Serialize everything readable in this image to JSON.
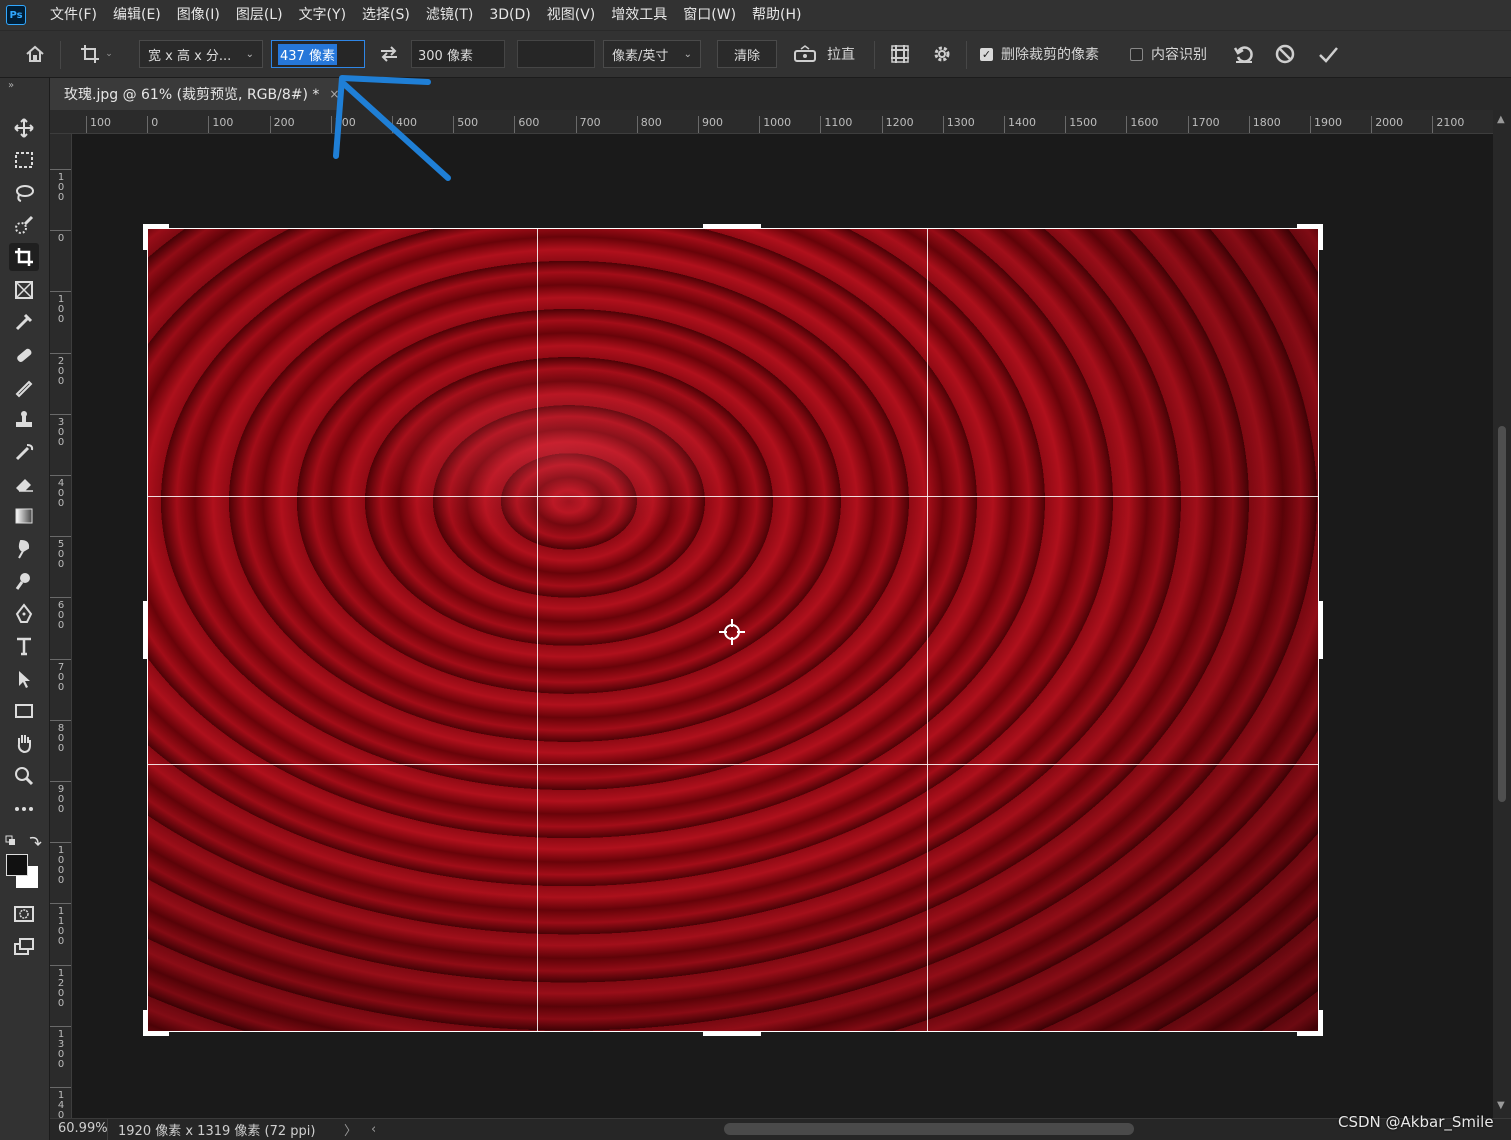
{
  "app": {
    "logo": "Ps"
  },
  "menu": [
    "文件(F)",
    "编辑(E)",
    "图像(I)",
    "图层(L)",
    "文字(Y)",
    "选择(S)",
    "滤镜(T)",
    "3D(D)",
    "视图(V)",
    "增效工具",
    "窗口(W)",
    "帮助(H)"
  ],
  "options": {
    "ratio_preset": "宽 x 高 x 分...",
    "width_value": "437 像素",
    "height_value": "300 像素",
    "resolution_value": "",
    "resolution_unit": "像素/英寸",
    "clear_label": "清除",
    "straighten_label": "拉直",
    "delete_cropped_label": "删除裁剪的像素",
    "delete_cropped_checked": true,
    "content_aware_label": "内容识别",
    "content_aware_checked": false
  },
  "document": {
    "tab_title": "玫瑰.jpg @ 61% (裁剪预览, RGB/8#) *",
    "close_glyph": "×"
  },
  "ruler": {
    "top_labels": [
      "100",
      "0",
      "100",
      "200",
      "300",
      "400",
      "500",
      "600",
      "700",
      "800",
      "900",
      "1000",
      "1100",
      "1200",
      "1300",
      "1400",
      "1500",
      "1600",
      "1700",
      "1800",
      "1900",
      "2000",
      "2100"
    ],
    "left_labels": [
      "100",
      "0",
      "100",
      "200",
      "300",
      "400",
      "500",
      "600",
      "700",
      "800",
      "900",
      "1000",
      "1100",
      "1200",
      "1300",
      "1400"
    ]
  },
  "status": {
    "zoom": "60.99%",
    "doc_size": "1920 像素 x 1319 像素 (72 ppi)",
    "arrow": "〉",
    "scroll_left": "‹"
  },
  "watermark": "CSDN @Akbar_Smile",
  "colors": {
    "annotation_arrow": "#1f7fd6",
    "selection": "#2677d9",
    "crop_frame": "#ffffff"
  },
  "tools": [
    "move-icon",
    "marquee-icon",
    "lasso-icon",
    "quick-select-icon",
    "crop-icon",
    "frame-icon",
    "eyedropper-icon",
    "healing-icon",
    "brush-icon",
    "stamp-icon",
    "history-brush-icon",
    "eraser-icon",
    "gradient-icon",
    "smudge-icon",
    "dodge-icon",
    "pen-icon",
    "type-icon",
    "path-select-icon",
    "rectangle-icon",
    "hand-icon",
    "zoom-icon",
    "more-icon"
  ]
}
